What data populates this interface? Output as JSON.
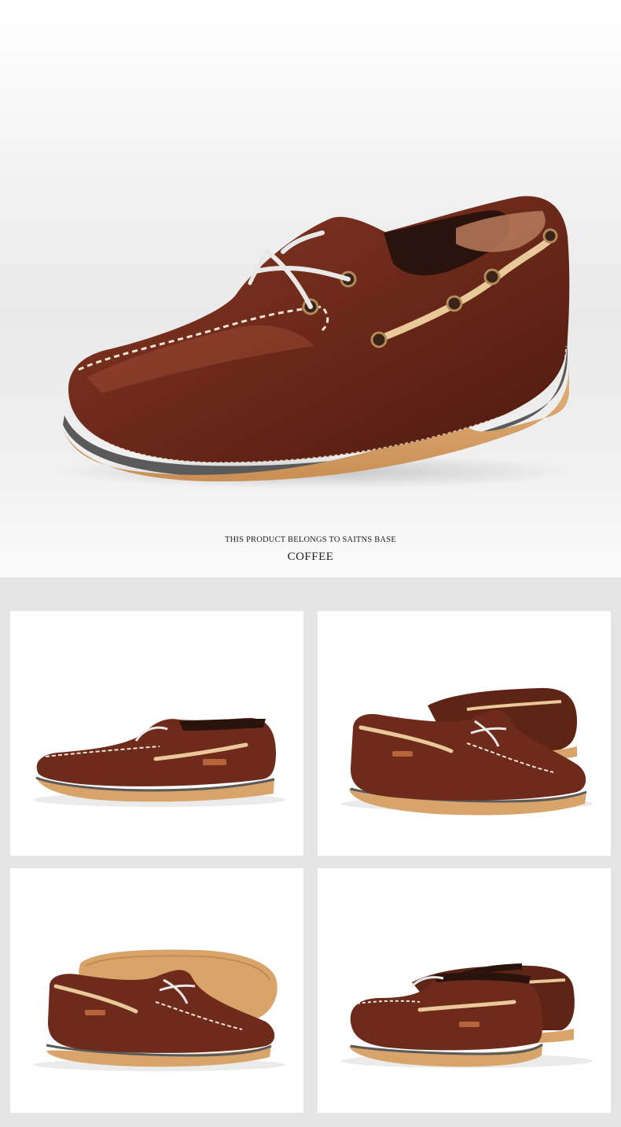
{
  "hero": {
    "caption_small": "THIS PRODUCT BELONGS TO SAITNS BASE",
    "caption_color": "COFFEE"
  },
  "colors": {
    "leather": "#6e2a1a",
    "leather_highlight": "#9c4a34",
    "sole": "#d9a46a",
    "midsole": "#5a5a5a",
    "stitch": "#efe5d6",
    "lace_tan": "#e9c99a"
  },
  "gallery": [
    {
      "view": "side-view"
    },
    {
      "view": "pair-front-view"
    },
    {
      "view": "pair-sole-view"
    },
    {
      "view": "pair-rear-view"
    }
  ]
}
